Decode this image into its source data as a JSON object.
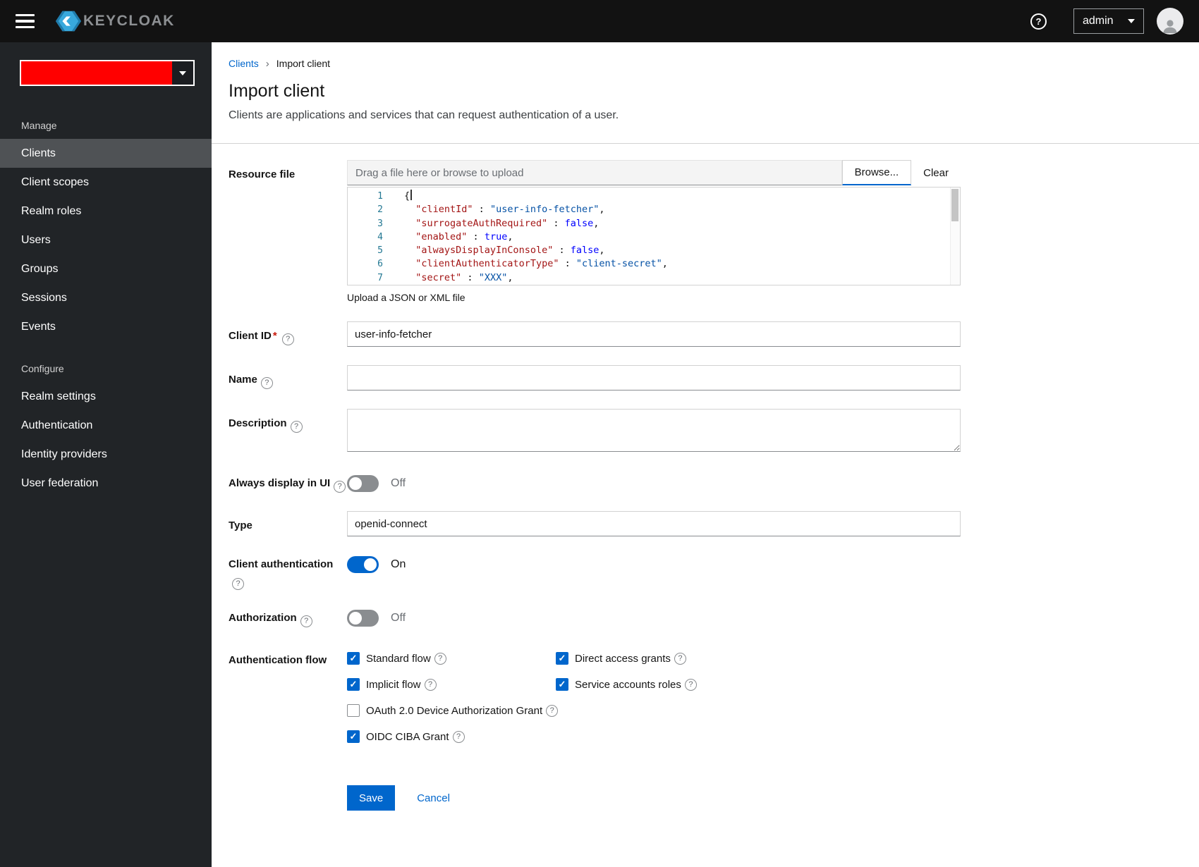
{
  "topbar": {
    "brand": "KEYCLOAK",
    "user_menu_label": "admin"
  },
  "sidebar": {
    "sections": [
      {
        "header": "Manage",
        "items": [
          {
            "label": "Clients",
            "active": true
          },
          {
            "label": "Client scopes",
            "active": false
          },
          {
            "label": "Realm roles",
            "active": false
          },
          {
            "label": "Users",
            "active": false
          },
          {
            "label": "Groups",
            "active": false
          },
          {
            "label": "Sessions",
            "active": false
          },
          {
            "label": "Events",
            "active": false
          }
        ]
      },
      {
        "header": "Configure",
        "items": [
          {
            "label": "Realm settings",
            "active": false
          },
          {
            "label": "Authentication",
            "active": false
          },
          {
            "label": "Identity providers",
            "active": false
          },
          {
            "label": "User federation",
            "active": false
          }
        ]
      }
    ]
  },
  "breadcrumb": {
    "parent": "Clients",
    "current": "Import client"
  },
  "page": {
    "title": "Import client",
    "subtitle": "Clients are applications and services that can request authentication of a user."
  },
  "form": {
    "resource_file": {
      "label": "Resource file",
      "placeholder": "Drag a file here or browse to upload",
      "browse_label": "Browse...",
      "clear_label": "Clear",
      "helper": "Upload a JSON or XML file"
    },
    "code_editor": {
      "lines": [
        {
          "no": "1",
          "tokens": [
            {
              "text": "{",
              "type": "plain"
            },
            {
              "text": "",
              "type": "cursor"
            }
          ]
        },
        {
          "no": "2",
          "tokens": [
            {
              "text": "  ",
              "type": "plain"
            },
            {
              "text": "\"clientId\"",
              "type": "key"
            },
            {
              "text": " : ",
              "type": "plain"
            },
            {
              "text": "\"user-info-fetcher\"",
              "type": "str"
            },
            {
              "text": ",",
              "type": "plain"
            }
          ]
        },
        {
          "no": "3",
          "tokens": [
            {
              "text": "  ",
              "type": "plain"
            },
            {
              "text": "\"surrogateAuthRequired\"",
              "type": "key"
            },
            {
              "text": " : ",
              "type": "plain"
            },
            {
              "text": "false",
              "type": "atom"
            },
            {
              "text": ",",
              "type": "plain"
            }
          ]
        },
        {
          "no": "4",
          "tokens": [
            {
              "text": "  ",
              "type": "plain"
            },
            {
              "text": "\"enabled\"",
              "type": "key"
            },
            {
              "text": " : ",
              "type": "plain"
            },
            {
              "text": "true",
              "type": "atom"
            },
            {
              "text": ",",
              "type": "plain"
            }
          ]
        },
        {
          "no": "5",
          "tokens": [
            {
              "text": "  ",
              "type": "plain"
            },
            {
              "text": "\"alwaysDisplayInConsole\"",
              "type": "key"
            },
            {
              "text": " : ",
              "type": "plain"
            },
            {
              "text": "false",
              "type": "atom"
            },
            {
              "text": ",",
              "type": "plain"
            }
          ]
        },
        {
          "no": "6",
          "tokens": [
            {
              "text": "  ",
              "type": "plain"
            },
            {
              "text": "\"clientAuthenticatorType\"",
              "type": "key"
            },
            {
              "text": " : ",
              "type": "plain"
            },
            {
              "text": "\"client-secret\"",
              "type": "str"
            },
            {
              "text": ",",
              "type": "plain"
            }
          ]
        },
        {
          "no": "7",
          "tokens": [
            {
              "text": "  ",
              "type": "plain"
            },
            {
              "text": "\"secret\"",
              "type": "key"
            },
            {
              "text": " : ",
              "type": "plain"
            },
            {
              "text": "\"XXX\"",
              "type": "str"
            },
            {
              "text": ",",
              "type": "plain"
            }
          ]
        }
      ]
    },
    "client_id": {
      "label": "Client ID",
      "required": "*",
      "value": "user-info-fetcher"
    },
    "name": {
      "label": "Name",
      "value": ""
    },
    "description": {
      "label": "Description",
      "value": ""
    },
    "always_display": {
      "label": "Always display in UI",
      "state_label": "Off",
      "on": false
    },
    "type": {
      "label": "Type",
      "value": "openid-connect"
    },
    "client_auth": {
      "label": "Client authentication",
      "state_label": "On",
      "on": true
    },
    "authorization": {
      "label": "Authorization",
      "state_label": "Off",
      "on": false
    },
    "auth_flow": {
      "label": "Authentication flow",
      "options": [
        {
          "label": "Standard flow",
          "checked": true
        },
        {
          "label": "Direct access grants",
          "checked": true
        },
        {
          "label": "Implicit flow",
          "checked": true
        },
        {
          "label": "Service accounts roles",
          "checked": true
        },
        {
          "label": "OAuth 2.0 Device Authorization Grant",
          "checked": false
        },
        {
          "label": "OIDC CIBA Grant",
          "checked": true
        }
      ]
    },
    "actions": {
      "save": "Save",
      "cancel": "Cancel"
    }
  },
  "colors": {
    "accent": "#0066cc",
    "realm_redacted": "#ff0000",
    "topbar": "#121212",
    "sidebar": "#212427"
  }
}
